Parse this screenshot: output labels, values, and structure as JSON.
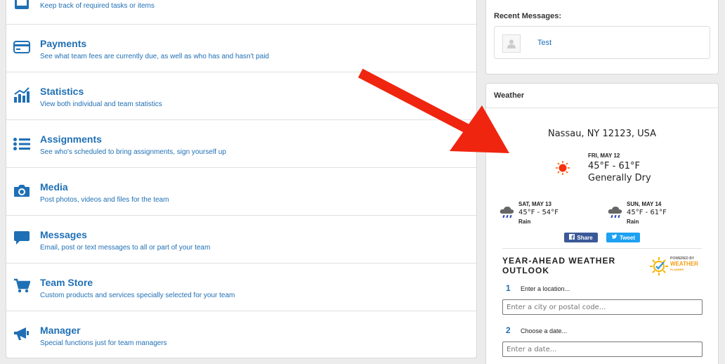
{
  "features": [
    {
      "name": "tasks",
      "title": "",
      "desc": "Keep track of required tasks or items",
      "icon": "checklist-icon"
    },
    {
      "name": "payments",
      "title": "Payments",
      "desc": "See what team fees are currently due, as well as who has and hasn't paid",
      "icon": "credit-card-icon"
    },
    {
      "name": "statistics",
      "title": "Statistics",
      "desc": "View both individual and team statistics",
      "icon": "bar-chart-icon"
    },
    {
      "name": "assignments",
      "title": "Assignments",
      "desc": "See who's scheduled to bring assignments, sign yourself up",
      "icon": "list-icon"
    },
    {
      "name": "media",
      "title": "Media",
      "desc": "Post photos, videos and files for the team",
      "icon": "camera-icon"
    },
    {
      "name": "messages",
      "title": "Messages",
      "desc": "Email, post or text messages to all or part of your team",
      "icon": "chat-bubble-icon"
    },
    {
      "name": "team-store",
      "title": "Team Store",
      "desc": "Custom products and services specially selected for your team",
      "icon": "shopping-cart-icon"
    },
    {
      "name": "manager",
      "title": "Manager",
      "desc": "Special functions just for team managers",
      "icon": "megaphone-icon"
    }
  ],
  "recent": {
    "heading": "Recent Messages:",
    "items": [
      {
        "text": "Test"
      }
    ]
  },
  "weather": {
    "heading": "Weather",
    "location": "Nassau, NY 12123, USA",
    "today": {
      "date": "FRI, MAY 12",
      "temp": "45°F - 61°F",
      "condition": "Generally Dry",
      "icon": "sun-icon"
    },
    "forecast": [
      {
        "date": "SAT, MAY 13",
        "temp": "45°F - 54°F",
        "condition": "Rain",
        "icon": "rain-cloud-icon"
      },
      {
        "date": "SUN, MAY 14",
        "temp": "45°F - 61°F",
        "condition": "Rain",
        "icon": "rain-cloud-icon"
      }
    ],
    "share_label": "Share",
    "tweet_label": "Tweet",
    "outlook_title": "YEAR-AHEAD WEATHER OUTLOOK",
    "powered_by": "POWERED BY",
    "planner_brand": "WEATHER",
    "planner_sub": "PLANNER",
    "step1": {
      "num": "1",
      "label": "Enter a location...",
      "placeholder": "Enter a city or postal code..."
    },
    "step2": {
      "num": "2",
      "label": "Choose a date...",
      "placeholder": "Enter a date..."
    }
  },
  "colors": {
    "accent": "#1f6fb5",
    "arrow": "#f0250f",
    "facebook": "#3b5998",
    "twitter": "#1da1f2"
  }
}
